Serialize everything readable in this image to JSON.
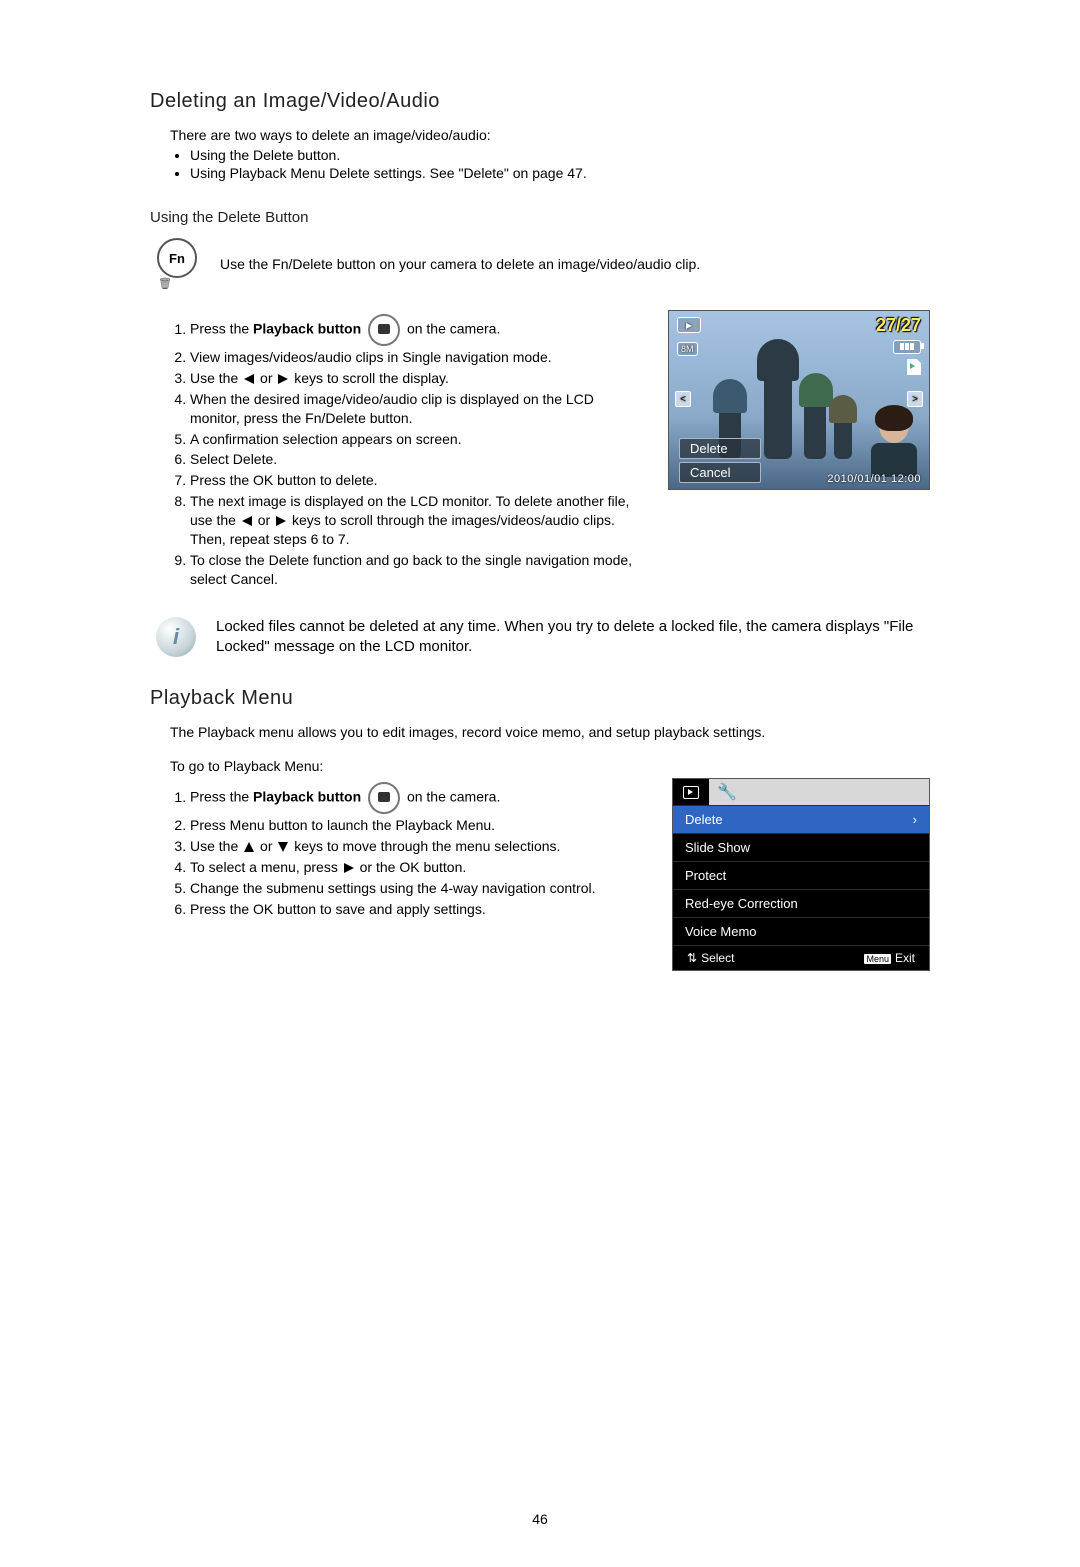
{
  "heading_delete": "Deleting an Image/Video/Audio",
  "intro_delete": "There are two ways to delete an image/video/audio:",
  "bullets": {
    "b1": "Using the Delete button.",
    "b2": "Using Playback Menu Delete settings. See \"Delete\" on page 47."
  },
  "sub_using_delete": "Using the Delete Button",
  "fn_label": "Fn",
  "fn_desc": "Use the Fn/Delete button on your camera to delete an image/video/audio clip.",
  "steps1": {
    "s1a": "Press the ",
    "s1b": "Playback button",
    "s1c": " on the camera.",
    "s2": "View images/videos/audio clips in Single navigation mode.",
    "s3a": "Use the ",
    "s3b": " or ",
    "s3c": " keys to scroll the display.",
    "s4": "When the desired image/video/audio clip is displayed on the LCD monitor, press the Fn/Delete button.",
    "s5": "A confirmation selection appears on screen.",
    "s6": "Select Delete.",
    "s7": "Press the OK button to delete.",
    "s8a": "The next image is displayed on the LCD monitor. To delete another file, use the ",
    "s8b": " or ",
    "s8c": " keys to scroll through the images/videos/audio clips. Then, repeat steps 6 to 7.",
    "s9": "To close the Delete function and go back to the single navigation mode, select Cancel."
  },
  "lcd1": {
    "counter": "27/27",
    "size_badge": "8M",
    "opt_delete": "Delete",
    "opt_cancel": "Cancel",
    "timestamp": "2010/01/01  12:00"
  },
  "note": "Locked files cannot be deleted at any time. When you try to delete a locked file, the camera displays \"File Locked\" message on the LCD monitor.",
  "heading_playback": "Playback Menu",
  "intro_playback": "The Playback menu allows you to edit images, record voice memo, and setup playback settings.",
  "sub_goto": "To go to Playback Menu:",
  "steps2": {
    "s1a": "Press the ",
    "s1b": "Playback button",
    "s1c": " on the camera.",
    "s2": "Press Menu button to launch the Playback Menu.",
    "s3a": "Use the ",
    "s3b": " or ",
    "s3c": " keys to move through the menu selections.",
    "s4a": "To select a menu, press ",
    "s4b": " or the OK button.",
    "s5": "Change the submenu settings using the 4-way navigation control.",
    "s6": "Press the OK button to save and apply settings."
  },
  "lcd2": {
    "m1": "Delete",
    "m2": "Slide Show",
    "m3": "Protect",
    "m4": "Red-eye Correction",
    "m5": "Voice Memo",
    "select": "Select",
    "menu_badge": "Menu",
    "exit": "Exit"
  },
  "page_number": "46"
}
